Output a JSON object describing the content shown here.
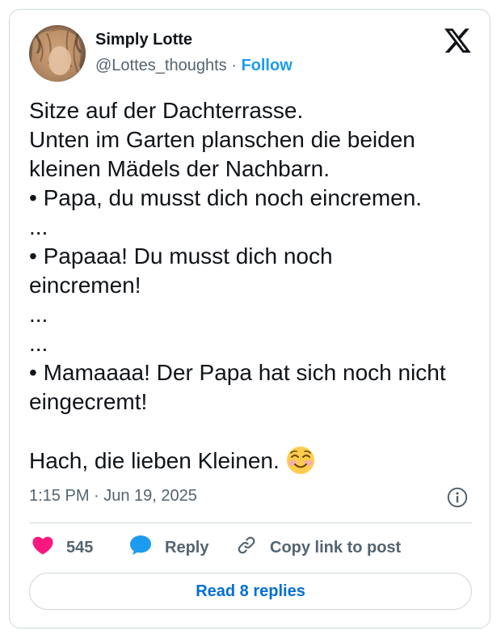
{
  "author": {
    "display_name": "Simply Lotte",
    "handle": "@Lottes_thoughts",
    "separator": "·",
    "follow_label": "Follow"
  },
  "tweet": {
    "lines": [
      "Sitze auf der Dachterrasse.",
      "Unten im Garten planschen die beiden",
      "kleinen Mädels der Nachbarn.",
      "• Papa, du musst dich noch eincremen.",
      "...",
      "• Papaaa! Du musst dich noch",
      "eincremen!",
      "...",
      "...",
      "• Mamaaaa! Der Papa hat sich noch nicht",
      "eingecremt!",
      "",
      "Hach, die lieben Kleinen."
    ],
    "trailing_emoji": "smiling-face-with-smiling-eyes-emoji",
    "timestamp": "1:15 PM · Jun 19, 2025"
  },
  "actions": {
    "like_count": "545",
    "reply_label": "Reply",
    "copy_link_label": "Copy link to post"
  },
  "replies_button_label": "Read 8 replies",
  "icons": {
    "logo": "x-logo-icon",
    "info": "info-icon",
    "like": "heart-icon",
    "reply": "speech-bubble-icon",
    "copy": "link-icon"
  },
  "colors": {
    "like": "#f91880",
    "reply_icon": "#1d9bf0",
    "follow": "#1d9bf0",
    "replies_button_text": "#006fd6",
    "secondary_text": "#536471",
    "border": "#cfd9de"
  }
}
